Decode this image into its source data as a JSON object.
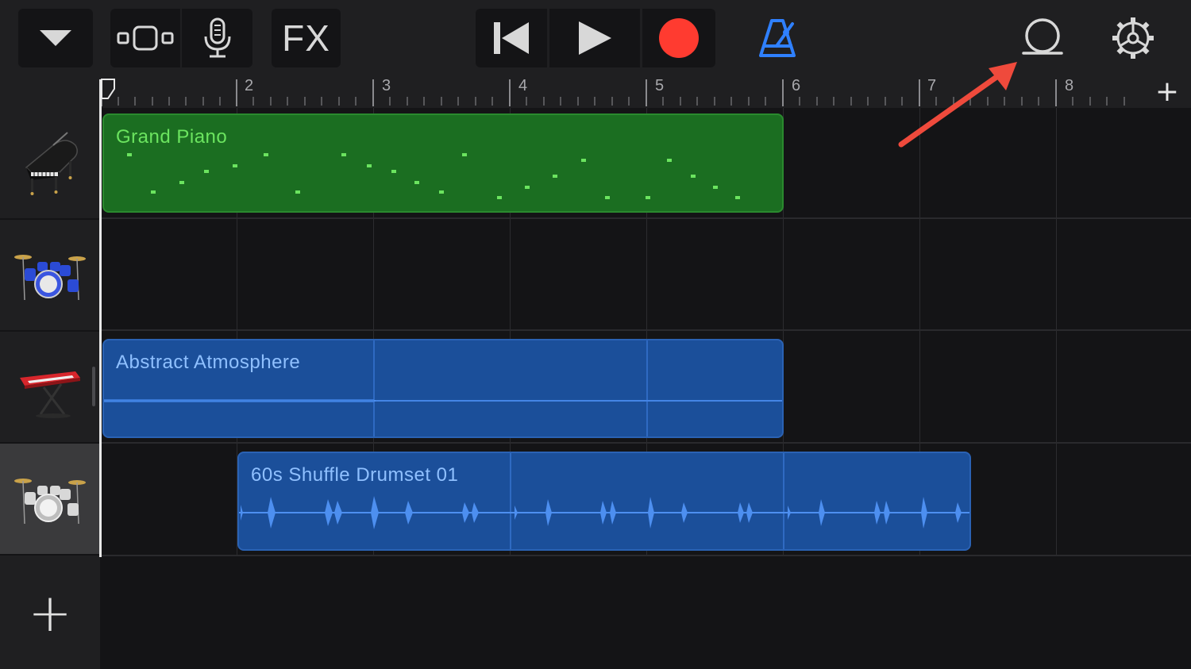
{
  "toolbar": {
    "browser_menu": "chevron-down-icon",
    "track_view": "tracks-view-icon",
    "microphone": "microphone-icon",
    "fx_label": "FX",
    "rewind": "skip-back-icon",
    "play": "play-icon",
    "record": "record-icon",
    "metronome": "metronome-icon",
    "loop_browser": "loop-icon",
    "settings": "gear-icon"
  },
  "colors": {
    "accent_blue": "#2f80ff",
    "record_red": "#ff3b30",
    "piano_green": "#1b6e21",
    "audio_blue": "#1b4f9a",
    "annotation_arrow": "#ef4a3c"
  },
  "ruler": {
    "bars": [
      "2",
      "3",
      "4",
      "5",
      "6",
      "7",
      "8"
    ],
    "add_section": "+"
  },
  "tracks": [
    {
      "instrument": "grand-piano-icon",
      "region": "Grand Piano"
    },
    {
      "instrument": "drum-kit-blue-icon",
      "region": ""
    },
    {
      "instrument": "keyboard-synth-icon",
      "region": "Abstract Atmosphere"
    },
    {
      "instrument": "drum-kit-silver-icon",
      "region": "60s Shuffle Drumset 01"
    }
  ],
  "add_track": "+"
}
